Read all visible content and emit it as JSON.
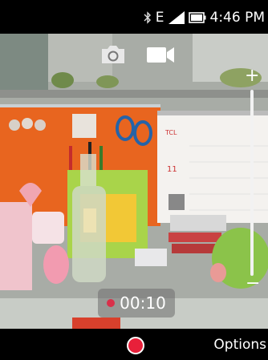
{
  "status_bar": {
    "network": "E",
    "time": "4:46 PM",
    "icons": [
      "bluetooth-icon",
      "signal-icon",
      "battery-icon"
    ]
  },
  "camera": {
    "modes": [
      {
        "name": "photo",
        "icon": "camera-icon",
        "selected": false
      },
      {
        "name": "video",
        "icon": "video-camera-icon",
        "selected": true
      }
    ],
    "zoom": {
      "plus": "+",
      "minus": "−",
      "level": 0
    },
    "recording": {
      "timer": "00:10",
      "indicator_color": "#d9304a"
    }
  },
  "softkeys": {
    "center_icon": "record-icon",
    "right": "Options",
    "record_color": "#e8203a"
  }
}
